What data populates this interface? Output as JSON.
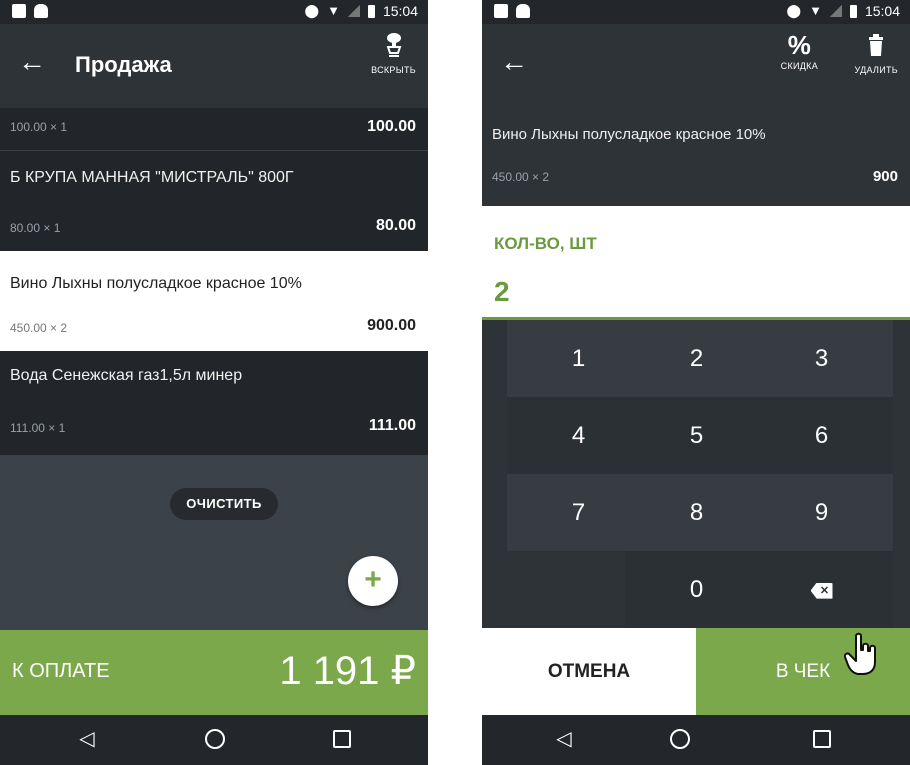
{
  "status_bar": {
    "time": "15:04"
  },
  "left_screen": {
    "title": "Продажа",
    "open_action_label": "ВСКРЫТЬ",
    "items": [
      {
        "name": "",
        "qty": "100.00 × 1",
        "sum": "100.00",
        "selected": false
      },
      {
        "name": "Б КРУПА МАННАЯ \"МИСТРАЛЬ\" 800Г",
        "qty": "80.00 × 1",
        "sum": "80.00",
        "selected": false
      },
      {
        "name": "Вино Лыхны полусладкое красное 10%",
        "qty": "450.00 × 2",
        "sum": "900.00",
        "selected": true
      },
      {
        "name": "Вода Сенежская газ1,5л минер",
        "qty": "111.00 × 1",
        "sum": "111.00",
        "selected": false
      }
    ],
    "clear_button": "ОЧИСТИТЬ",
    "fab_label": "+",
    "pay_label": "К ОПЛАТЕ",
    "pay_amount": "1 191 ₽"
  },
  "right_screen": {
    "discount_label": "СКИДКА",
    "delete_label": "УДАЛИТЬ",
    "item": {
      "name": "Вино Лыхны полусладкое красное 10%",
      "qty": "450.00 × 2",
      "sum": "900"
    },
    "quantity_label": "КОЛ-ВО, ШТ",
    "quantity_value": "2",
    "keys": [
      "1",
      "2",
      "3",
      "4",
      "5",
      "6",
      "7",
      "8",
      "9",
      "0"
    ],
    "cancel_button": "ОТМЕНА",
    "to_check_button": "В ЧЕК"
  },
  "icons": {
    "back": "arrow-left-icon",
    "open": "bottle-open-icon",
    "discount": "percent-icon",
    "delete": "trash-icon",
    "backspace": "backspace-icon",
    "nav_back": "triangle-back-icon",
    "nav_home": "circle-home-icon",
    "nav_recent": "square-recent-icon",
    "cursor": "hand-pointer-icon"
  },
  "colors": {
    "accent": "#7aa84a",
    "dark_bg": "#22262a",
    "toolbar_bg": "#2e3338",
    "selected_bg": "#ffffff"
  }
}
